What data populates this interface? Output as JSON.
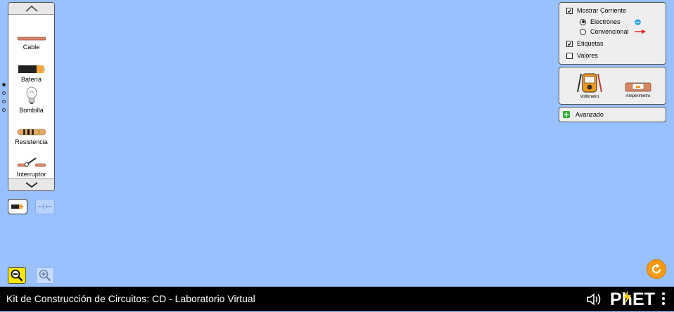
{
  "app": {
    "title": "Kit de Construcción de Circuitos: CD - Laboratorio Virtual",
    "logo_text": "PhET"
  },
  "carousel": {
    "items": [
      {
        "label": "Cable",
        "icon": "wire-icon"
      },
      {
        "label": "Batería",
        "icon": "battery-icon"
      },
      {
        "label": "Bombilla",
        "icon": "lightbulb-icon"
      },
      {
        "label": "Resistencia",
        "icon": "resistor-icon"
      },
      {
        "label": "Interruptor",
        "icon": "switch-icon"
      }
    ],
    "page_count": 4,
    "current_page": 1
  },
  "view_mode": {
    "options": [
      "lifelike",
      "schematic"
    ],
    "selected": "lifelike"
  },
  "display_panel": {
    "show_current": {
      "label": "Mostrar Corriente",
      "checked": true
    },
    "current_type": {
      "options": [
        {
          "label": "Electrones",
          "selected": true,
          "icon": "electron-icon"
        },
        {
          "label": "Convencional",
          "selected": false,
          "icon": "red-arrow-icon"
        }
      ]
    },
    "labels": {
      "label": "Etiquetas",
      "checked": true
    },
    "values": {
      "label": "Valores",
      "checked": false
    }
  },
  "sensors": [
    {
      "label": "Voltímetro",
      "icon": "voltmeter-icon"
    },
    {
      "label": "Amperímetro",
      "icon": "ammeter-icon"
    }
  ],
  "advanced": {
    "label": "Avanzado",
    "expanded": false
  },
  "colors": {
    "canvas": "#99c0ff",
    "panel": "#eeeeee",
    "navbar": "#000000",
    "reset": "#f79a0e",
    "zoom_out_active": "#ffe600"
  }
}
